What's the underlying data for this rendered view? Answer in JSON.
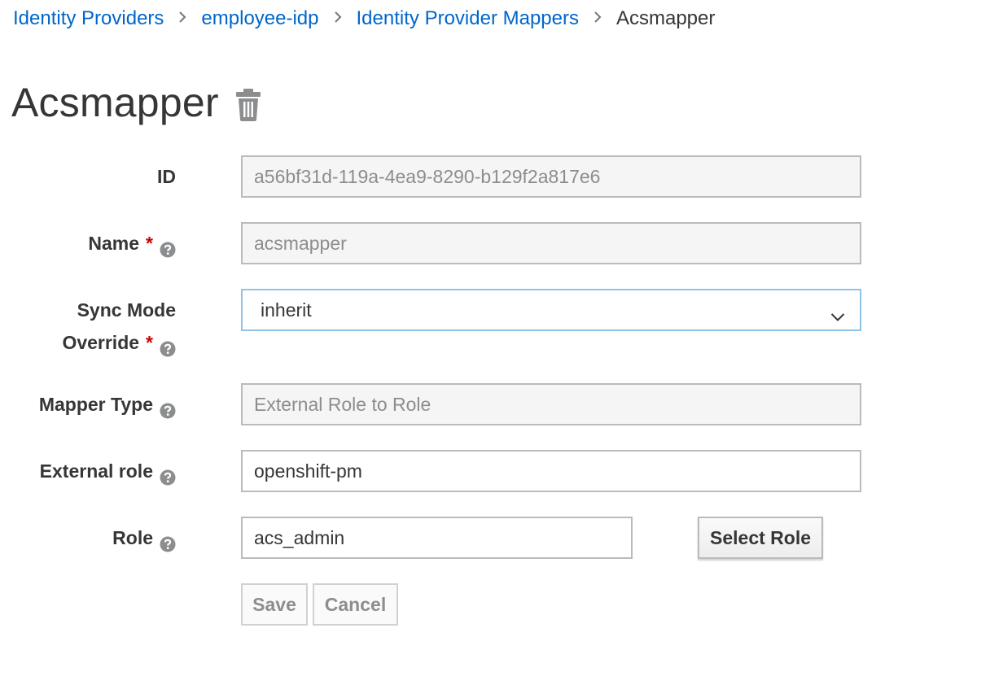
{
  "breadcrumb": {
    "items": [
      {
        "label": "Identity Providers"
      },
      {
        "label": "employee-idp"
      },
      {
        "label": "Identity Provider Mappers"
      }
    ],
    "current": "Acsmapper"
  },
  "page": {
    "title": "Acsmapper"
  },
  "form": {
    "id": {
      "label": "ID",
      "value": "a56bf31d-119a-4ea9-8290-b129f2a817e6"
    },
    "name": {
      "label": "Name",
      "value": "acsmapper",
      "required_mark": "*"
    },
    "sync_mode": {
      "label_line1": "Sync Mode",
      "label_line2": "Override",
      "value": "inherit",
      "required_mark": "*"
    },
    "mapper_type": {
      "label": "Mapper Type",
      "value": "External Role to Role"
    },
    "external_role": {
      "label": "External role",
      "value": "openshift-pm"
    },
    "role": {
      "label": "Role",
      "value": "acs_admin"
    }
  },
  "buttons": {
    "select_role": "Select Role",
    "save": "Save",
    "cancel": "Cancel"
  },
  "colors": {
    "link": "#0066cc",
    "required": "#cc0000",
    "text": "#363636",
    "readonly_bg": "#f5f5f5",
    "focus_border": "#8fc3ea"
  },
  "icons": {
    "delete": "trash-icon",
    "help": "help-icon",
    "dropdown": "chevron-down-icon"
  }
}
